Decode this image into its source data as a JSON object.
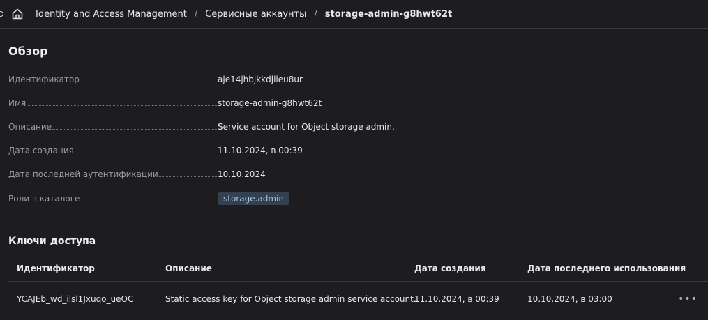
{
  "breadcrumb": {
    "items": [
      "Identity and Access Management",
      "Сервисные аккаунты",
      "storage-admin-g8hwt62t"
    ],
    "separator": "/"
  },
  "overview": {
    "title": "Обзор",
    "fields": [
      {
        "label": "Идентификатор",
        "value": "aje14jhbjkkdjiieu8ur"
      },
      {
        "label": "Имя",
        "value": "storage-admin-g8hwt62t"
      },
      {
        "label": "Описание",
        "value": "Service account for Object storage admin."
      },
      {
        "label": "Дата создания",
        "value": "11.10.2024, в 00:39"
      },
      {
        "label": "Дата последней аутентификации",
        "value": "10.10.2024"
      },
      {
        "label": "Роли в каталоге",
        "value": "storage.admin"
      }
    ]
  },
  "access_keys": {
    "title": "Ключи доступа",
    "columns": [
      "Идентификатор",
      "Описание",
      "Дата создания",
      "Дата последнего использования"
    ],
    "rows": [
      [
        "YCAJEb_wd_ilsl1Jxuqo_ueOC",
        "Static access key for Object storage admin service account.",
        "11.10.2024, в 00:39",
        "10.10.2024, в 03:00"
      ]
    ],
    "row_menu_icon": "ellipsis-icon"
  },
  "icons": {
    "home": "home-icon"
  },
  "colors": {
    "background": "#1d1d20",
    "role_chip_bg": "#33404f",
    "role_chip_text": "#a9c3e0"
  }
}
